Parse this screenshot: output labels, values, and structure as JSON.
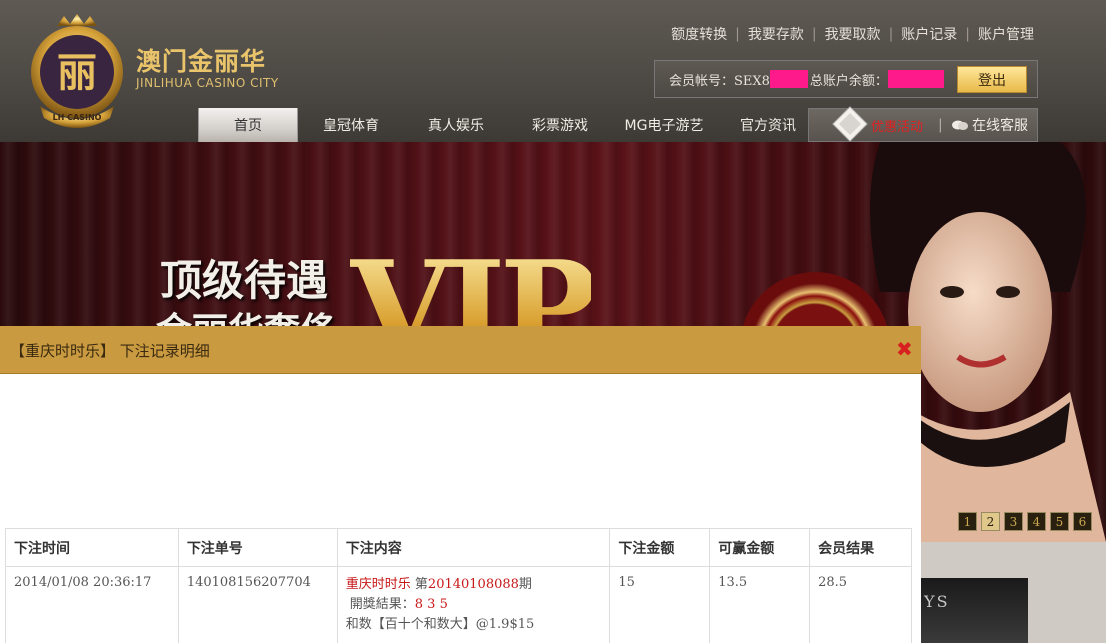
{
  "header": {
    "brand_cn": "澳门金丽华",
    "brand_en": "JINLIHUA CASINO CITY",
    "badge_text": "LH CASINO",
    "top_links": [
      "额度转换",
      "我要存款",
      "我要取款",
      "账户记录",
      "账户管理"
    ],
    "account": {
      "member_label": "会员帐号：SEX8",
      "balance_label": "总账户余额：",
      "logout": "登出"
    },
    "nav": [
      "首页",
      "皇冠体育",
      "真人娱乐",
      "彩票游戏",
      "MG电子游艺",
      "官方资讯"
    ],
    "promo": "优惠活动",
    "service": "在线客服"
  },
  "banner": {
    "headline": "顶级待遇",
    "subline": "金丽华奢侈",
    "vip": "VIP",
    "pages": [
      "1",
      "2",
      "3",
      "4",
      "5",
      "6"
    ],
    "current_page": "2"
  },
  "lower_thumb_text": "YS",
  "modal": {
    "title": "【重庆时时乐】 下注记录明细",
    "columns": [
      "下注时间",
      "下注单号",
      "下注内容",
      "下注金额",
      "可赢金额",
      "会员结果"
    ],
    "row": {
      "time": "2014/01/08 20:36:17",
      "order_no": "140108156207704",
      "game": "重庆时时乐",
      "period_prefix": " 第",
      "period": "20140108088",
      "period_suffix": "期",
      "result_label": "開獎結果：",
      "result_digits": "8 3 5",
      "bet_detail": "和数【百十个和数大】@1.9$15",
      "amount": "15",
      "win_amount": "13.5",
      "member_result": "28.5"
    }
  },
  "colors": {
    "modal_header": "#c99a3f",
    "redact": "#ff1a8c",
    "highlight_red": "#c81818"
  }
}
